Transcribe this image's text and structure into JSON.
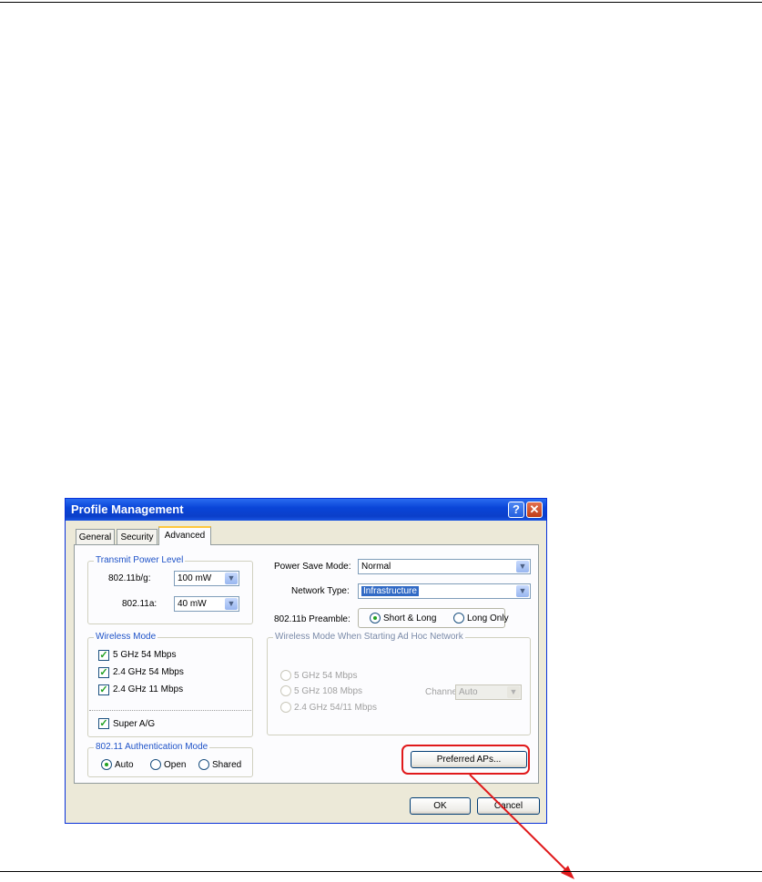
{
  "dialog": {
    "title": "Profile Management",
    "help_glyph": "?",
    "close_glyph": "✕"
  },
  "tabs": [
    {
      "label": "General"
    },
    {
      "label": "Security"
    },
    {
      "label": "Advanced"
    }
  ],
  "transmit_power": {
    "legend": "Transmit Power Level",
    "bg_label": "802.11b/g:",
    "bg_value": "100 mW",
    "a_label": "802.11a:",
    "a_value": "40 mW"
  },
  "power_save": {
    "label": "Power Save Mode:",
    "value": "Normal"
  },
  "network_type": {
    "label": "Network Type:",
    "value": "Infrastructure"
  },
  "preamble": {
    "label": "802.11b Preamble:",
    "option1": "Short & Long",
    "option2": "Long Only",
    "selected": "Short & Long"
  },
  "wireless_mode": {
    "legend": "Wireless Mode",
    "items": [
      "5 GHz 54 Mbps",
      "2.4 GHz 54 Mbps",
      "2.4 GHz 11 Mbps"
    ],
    "super": "Super A/G"
  },
  "adhoc": {
    "legend": "Wireless Mode When Starting Ad Hoc Network",
    "options": [
      "5 GHz 54 Mbps",
      "5 GHz 108 Mbps",
      "2.4 GHz 54/11 Mbps"
    ],
    "channel_label": "Channel:",
    "channel_value": "Auto"
  },
  "auth": {
    "legend": "802.11 Authentication Mode",
    "options": [
      "Auto",
      "Open",
      "Shared"
    ],
    "selected": "Auto"
  },
  "buttons": {
    "preferred": "Preferred APs...",
    "ok": "OK",
    "cancel": "Cancel"
  },
  "colors": {
    "highlight": "#e0191b",
    "titlebar": "#0a45d8",
    "accent_tab": "#ffc83c"
  }
}
